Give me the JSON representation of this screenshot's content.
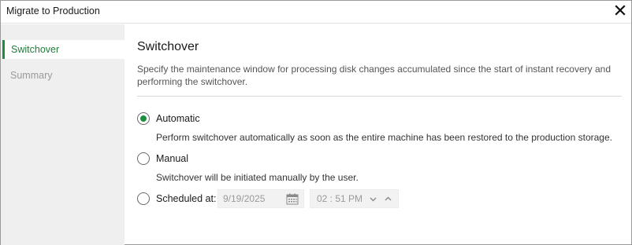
{
  "window": {
    "title": "Migrate to Production"
  },
  "sidebar": {
    "items": [
      {
        "label": "Switchover",
        "active": true
      },
      {
        "label": "Summary",
        "active": false
      }
    ]
  },
  "main": {
    "heading": "Switchover",
    "description": "Specify the maintenance window for processing disk changes accumulated since the start of instant recovery and performing the switchover.",
    "options": [
      {
        "label": "Automatic",
        "description": "Perform switchover automatically as soon as the entire machine has been restored to the production storage.",
        "selected": true
      },
      {
        "label": "Manual",
        "description": "Switchover will be initiated manually by the user.",
        "selected": false
      },
      {
        "label": "Scheduled at:",
        "selected": false
      }
    ],
    "schedule": {
      "date": "9/19/2025",
      "time": "02 : 51 PM"
    }
  },
  "colors": {
    "accent": "#1e8e3e",
    "sidebar_bg": "#efefef",
    "disabled_field_bg": "#f2f2f2"
  },
  "icons": {
    "close": "close-icon",
    "calendar": "calendar-icon",
    "time_down": "chevron-down-icon",
    "time_up": "chevron-up-icon"
  }
}
